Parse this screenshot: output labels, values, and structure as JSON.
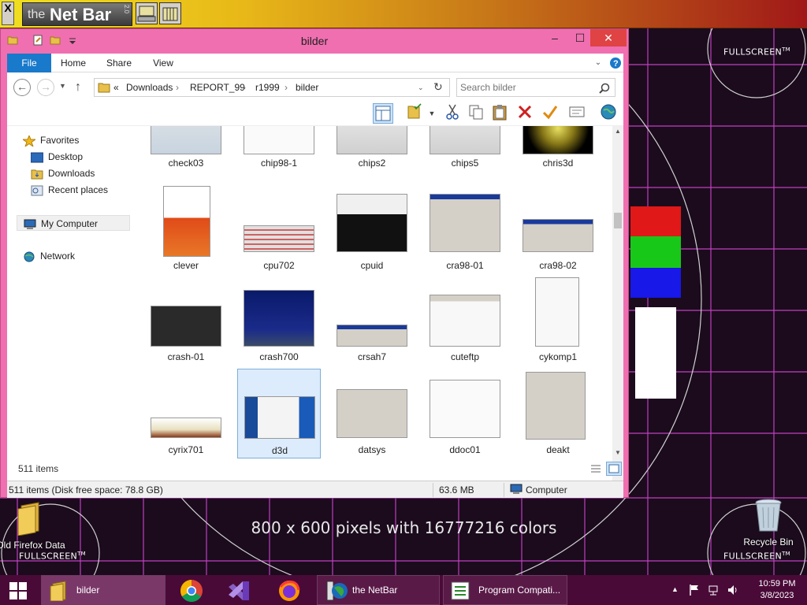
{
  "netbar": {
    "close_glyph": "X",
    "logo_the": "the",
    "logo_name": "Net Bar",
    "logo_version": "2.0"
  },
  "desktop": {
    "fullscreen_label": "FULLSCREEN",
    "tm": "TM",
    "pixel_info": "800 x 600 pixels with 16777216 colors",
    "icons": [
      {
        "label": "Old Firefox Data",
        "icon": "folder-icon"
      },
      {
        "label": "Recycle Bin",
        "icon": "recycle-bin-icon"
      }
    ],
    "test_colors": [
      "#e01818",
      "#18c818",
      "#1818e8"
    ]
  },
  "window": {
    "title": "bilder",
    "controls": {
      "minimize": "–",
      "maximize": "☐",
      "close": "✕"
    },
    "ribbon_tabs": [
      "File",
      "Home",
      "Share",
      "View"
    ],
    "address": {
      "prefix": "«",
      "segments": [
        "Downloads",
        "REPORT_99",
        "r1999",
        "bilder"
      ]
    },
    "search": {
      "placeholder": "Search bilder"
    },
    "nav": {
      "favorites": "Favorites",
      "desktop": "Desktop",
      "downloads": "Downloads",
      "recent": "Recent places",
      "my_computer": "My Computer",
      "network": "Network"
    },
    "files": [
      "check03",
      "chip98-1",
      "chips2",
      "chips5",
      "chris3d",
      "clever",
      "cpu702",
      "cpuid",
      "cra98-01",
      "cra98-02",
      "crash-01",
      "crash700",
      "crsah7",
      "cuteftp",
      "cykomp1",
      "cyrix701",
      "d3d",
      "datsys",
      "ddoc01",
      "deakt"
    ],
    "selected_file": "d3d",
    "item_count": "511 items",
    "status": {
      "left": "511 items (Disk free space: 78.8 GB)",
      "size": "63.6 MB",
      "location": "Computer"
    }
  },
  "taskbar": {
    "items": [
      {
        "label": "bilder",
        "icon": "folder-icon"
      },
      {
        "label": "",
        "icon": "chrome-icon"
      },
      {
        "label": "",
        "icon": "visual-studio-icon"
      },
      {
        "label": "",
        "icon": "firefox-icon"
      },
      {
        "label": "the NetBar",
        "icon": "netbar-icon"
      },
      {
        "label": "Program Compati...",
        "icon": "program-compat-icon"
      }
    ],
    "time": "10:59 PM",
    "date": "3/8/2023"
  }
}
